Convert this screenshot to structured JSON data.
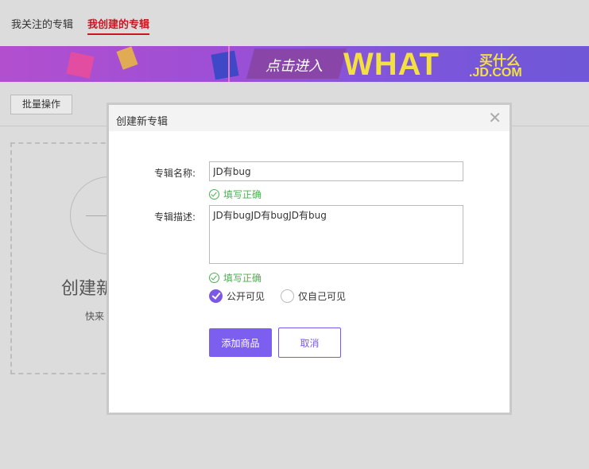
{
  "tabs": {
    "follow": "我关注的专辑",
    "mine": "我创建的专辑"
  },
  "banner": {
    "click_text": "点击进入",
    "what": "WHAT",
    "mai": "买什么",
    "jd": ".JD.COM"
  },
  "toolbar": {
    "batch_label": "批量操作"
  },
  "card": {
    "title": "创建新",
    "desc": "快来"
  },
  "dialog": {
    "title": "创建新专辑",
    "close": "✕",
    "name_label": "专辑名称:",
    "name_value": "JD有bug",
    "name_ok": "填写正确",
    "desc_label": "专辑描述:",
    "desc_value": "JD有bugJD有bugJD有bug",
    "desc_ok": "填写正确",
    "vis_public": "公开可见",
    "vis_private": "仅自己可见",
    "add_label": "添加商品",
    "cancel_label": "取消"
  },
  "colors": {
    "accent": "#7b57e8",
    "ok": "#4caf50",
    "tab_active": "#c81623"
  }
}
